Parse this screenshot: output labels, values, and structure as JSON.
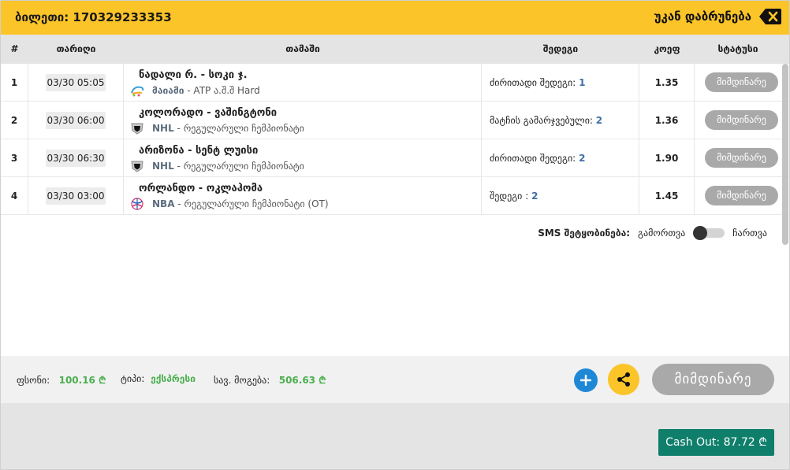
{
  "header": {
    "ticket_label": "ბილეთი: 170329233353",
    "back_label": "უკან დაბრუნება",
    "back_icon": "backspace-icon"
  },
  "table": {
    "columns": {
      "num": "#",
      "date": "თარიღი",
      "game": "თამაში",
      "result": "შედეგი",
      "odds": "კოეფ",
      "status": "სტატუსი"
    },
    "rows": [
      {
        "num": "1",
        "date": "03/30 05:05",
        "match": "ნადალი რ. - სოკი ჯ.",
        "league_icon": "tennis-icon",
        "league_name": "მაიამი",
        "league_detail": " - ATP ა.შ.შ Hard",
        "result_label": "ძირითადი შედეგი:",
        "result_value": "1",
        "odds": "1.35",
        "status": "მიმდინარე"
      },
      {
        "num": "2",
        "date": "03/30 06:00",
        "match": "კოლორადო - ვაშინგტონი",
        "league_icon": "nhl-icon",
        "league_name": "NHL",
        "league_detail": " - რეგულარული ჩემპიონატი",
        "result_label": "მატჩის გამარჯვებული:",
        "result_value": "2",
        "odds": "1.36",
        "status": "მიმდინარე"
      },
      {
        "num": "3",
        "date": "03/30 06:30",
        "match": "არიზონა - სენტ ლუისი",
        "league_icon": "nhl-icon",
        "league_name": "NHL",
        "league_detail": " - რეგულარული ჩემპიონატი",
        "result_label": "ძირითადი შედეგი:",
        "result_value": "2",
        "odds": "1.90",
        "status": "მიმდინარე"
      },
      {
        "num": "4",
        "date": "03/30 03:00",
        "match": "ორლანდო - ოკლაჰომა",
        "league_icon": "nba-icon",
        "league_name": "NBA",
        "league_detail": " - რეგულარული ჩემპიონატი (OT)",
        "result_label": "შედეგი :",
        "result_value": "2",
        "odds": "1.45",
        "status": "მიმდინარე"
      }
    ]
  },
  "sms": {
    "label": "SMS შეტყობინება:",
    "off_label": "გამორთვა",
    "on_label": "ჩართვა",
    "enabled": false
  },
  "footer": {
    "stake_label": "ფსონი:",
    "stake_value": "100.16 ₾",
    "type_label": "ტიპი:",
    "type_value": "ექსპრესი",
    "win_label": "სავ. მოგება:",
    "win_value": "506.63 ₾",
    "plus_icon": "plus-icon",
    "share_icon": "share-icon",
    "status": "მიმდინარე"
  },
  "cashout": {
    "label": "Cash Out: 87.72 ₾"
  },
  "colors": {
    "accent": "#fbc428",
    "cashout": "#0f7f6b",
    "status_pill": "#a9a9a9",
    "positive": "#4caf50",
    "link": "#3f6fa5"
  }
}
